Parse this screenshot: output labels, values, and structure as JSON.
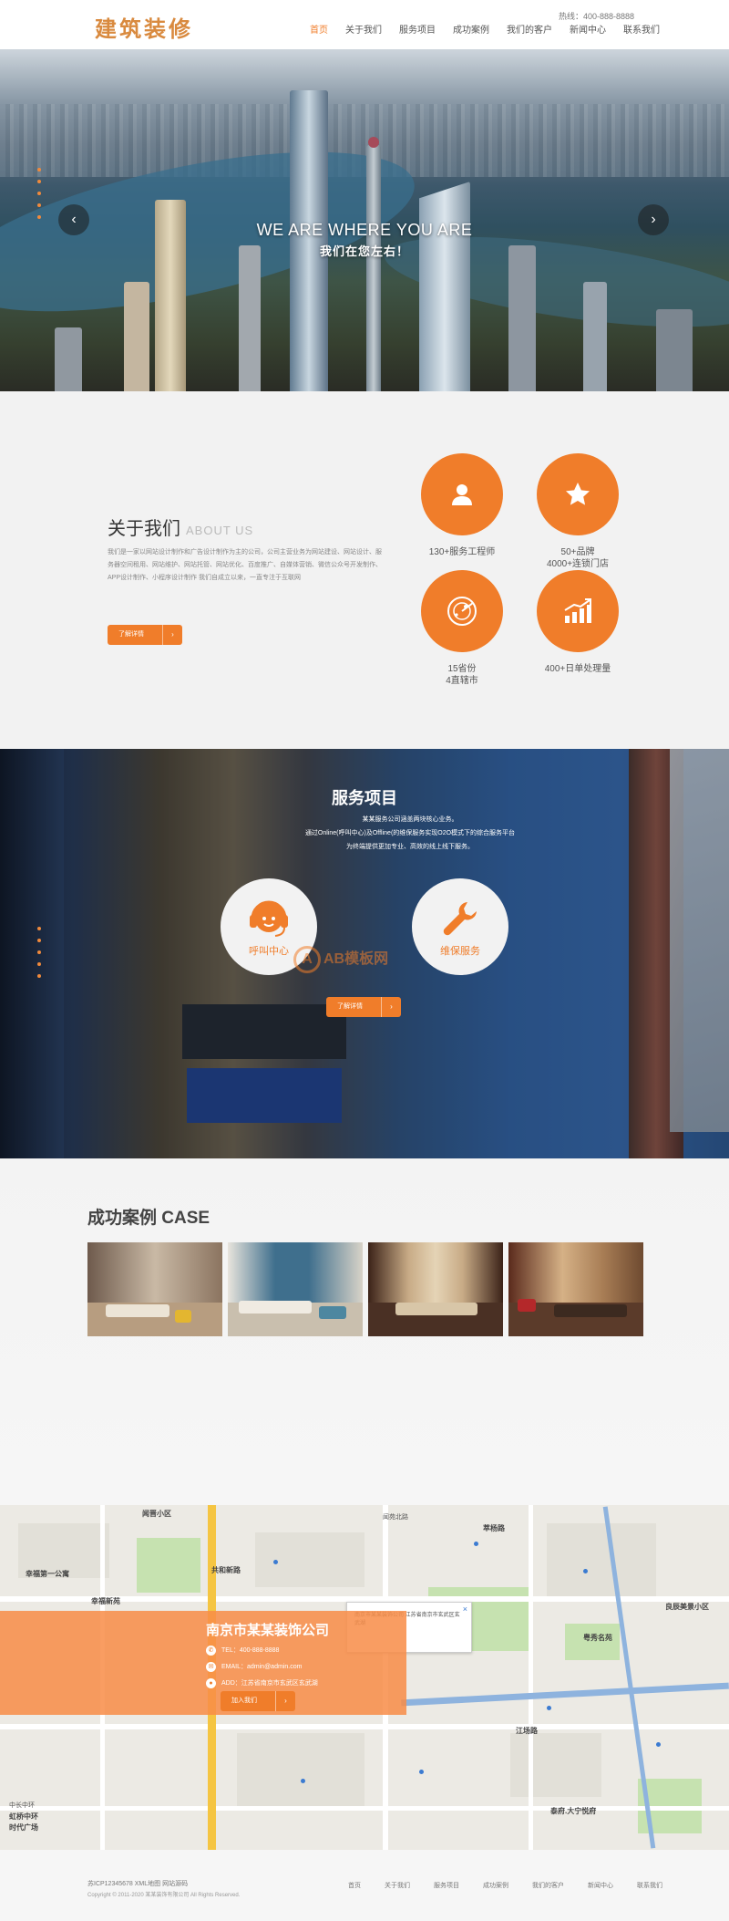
{
  "header": {
    "logo": "建筑装修",
    "phone": "热线：400-888-8888",
    "nav": [
      "首页",
      "关于我们",
      "服务项目",
      "成功案例",
      "我们的客户",
      "新闻中心",
      "联系我们"
    ],
    "accent": "#f07d2a"
  },
  "hero": {
    "title_en": "WE ARE WHERE YOU ARE",
    "title_cn": "我们在您左右！",
    "prev_icon": "chevron-left-icon",
    "next_icon": "chevron-right-icon"
  },
  "about": {
    "title": "关于我们",
    "title_en": "ABOUT US",
    "body": "我们是一家以网站设计制作和广告设计制作为主的公司，公司主营业务为网站建设、网站设计、服务器空间租用、网站维护、网站托管、网站优化、百度推广、自媒体营销、微信公众号开发制作、APP设计制作、小程序设计制作 我们自成立以来，一直专注于互联网",
    "button": "了解详情",
    "stats": [
      {
        "icon": "user-icon",
        "label1": "130+服务工程师",
        "label2": ""
      },
      {
        "icon": "star-icon",
        "label1": "50+品牌",
        "label2": "4000+连锁门店"
      },
      {
        "icon": "radar-icon",
        "label1": "15省份",
        "label2": "4直辖市"
      },
      {
        "icon": "chart-up-icon",
        "label1": "400+日单处理量",
        "label2": ""
      }
    ]
  },
  "services": {
    "title": "服务项目",
    "desc1": "某某服务公司涵盖两块核心业务。",
    "desc2": "通过Online(呼叫中心)及Offline(的维保服务实现O2O模式下的综合服务平台",
    "desc3": "为终端提供更加专业、高效的线上线下服务。",
    "items": [
      {
        "icon": "headset-icon",
        "label": "呼叫中心"
      },
      {
        "icon": "wrench-icon",
        "label": "维保服务"
      }
    ],
    "button": "了解详情",
    "watermark": "AB模板网"
  },
  "cases": {
    "title": "成功案例 CASE"
  },
  "map": {
    "labels": [
      "闻晋小区",
      "幸福第一公寓",
      "幸福新苑",
      "萃杨路",
      "虹桥中环",
      "时代广场",
      "共和新路",
      "江场路",
      "闻苑北路",
      "粤秀名苑",
      "良辰美景小区",
      "泰府.大宁悦府",
      "中长中环"
    ],
    "popup": "南京市某某装饰公司 江苏省南京市玄武区玄武湖",
    "contact": {
      "company": "南京市某某装饰公司",
      "tel": "TEL：400-888-8888",
      "email": "EMAIL：admin@admin.com",
      "addr": "ADD：江苏省南京市玄武区玄武湖",
      "button": "加入我们"
    }
  },
  "footer": {
    "icp": "苏ICP12345678 XML地图 网站源码",
    "copyright": "Copyright © 2011-2020 某某装饰有限公司 All Rights Reserved.",
    "nav": [
      "首页",
      "关于我们",
      "服务项目",
      "成功案例",
      "我们的客户",
      "新闻中心",
      "联系我们"
    ]
  }
}
